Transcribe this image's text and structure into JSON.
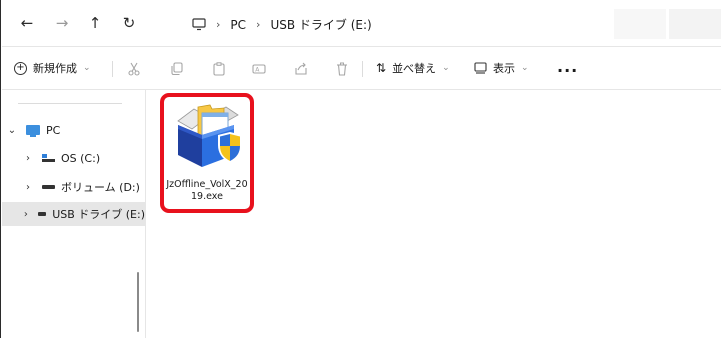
{
  "address_bar": {
    "crumbs": [
      "PC",
      "USB ドライブ (E:)"
    ]
  },
  "command_bar": {
    "new_label": "新規作成",
    "sort_label": "並べ替え",
    "view_label": "表示",
    "more_label": "..."
  },
  "nav_pane": {
    "items": [
      {
        "label": "PC"
      },
      {
        "label": "OS (C:)"
      },
      {
        "label": "ボリューム (D:)"
      },
      {
        "label": "USB ドライブ (E:)"
      }
    ]
  },
  "files": [
    {
      "name": "JzOffline_VolX_2019.exe"
    }
  ],
  "colors": {
    "highlight_border": "#e8111d",
    "selected_nav_bg": "#e6e6e6",
    "accent": "#3c8fde"
  }
}
